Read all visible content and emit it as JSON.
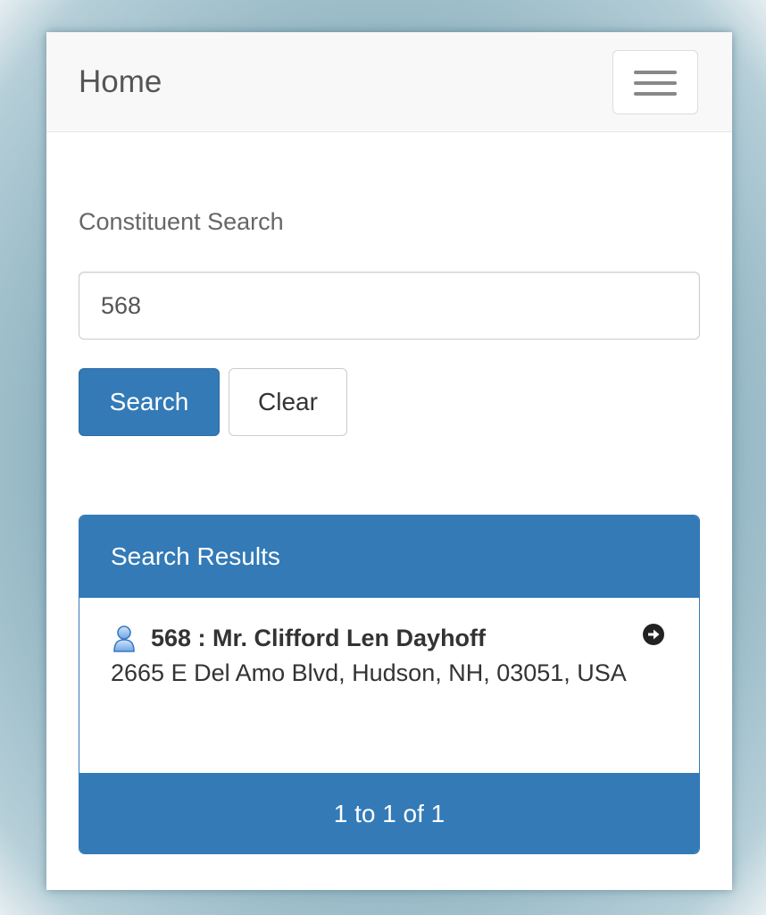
{
  "navbar": {
    "brand": "Home",
    "menu_icon": "hamburger-menu-icon"
  },
  "search": {
    "label": "Constituent Search",
    "value": "568",
    "search_label": "Search",
    "clear_label": "Clear"
  },
  "results": {
    "heading": "Search Results",
    "items": [
      {
        "icon": "person-icon",
        "title": "568 : Mr. Clifford Len Dayhoff",
        "address": "2665 E Del Amo Blvd, Hudson, NH, 03051, USA",
        "action_icon": "arrow-right-circle-icon"
      }
    ],
    "pagination": "1 to 1 of 1"
  },
  "colors": {
    "primary": "#337ab7",
    "navbar_bg": "#f8f8f8",
    "frame": "#8fb3c1"
  }
}
